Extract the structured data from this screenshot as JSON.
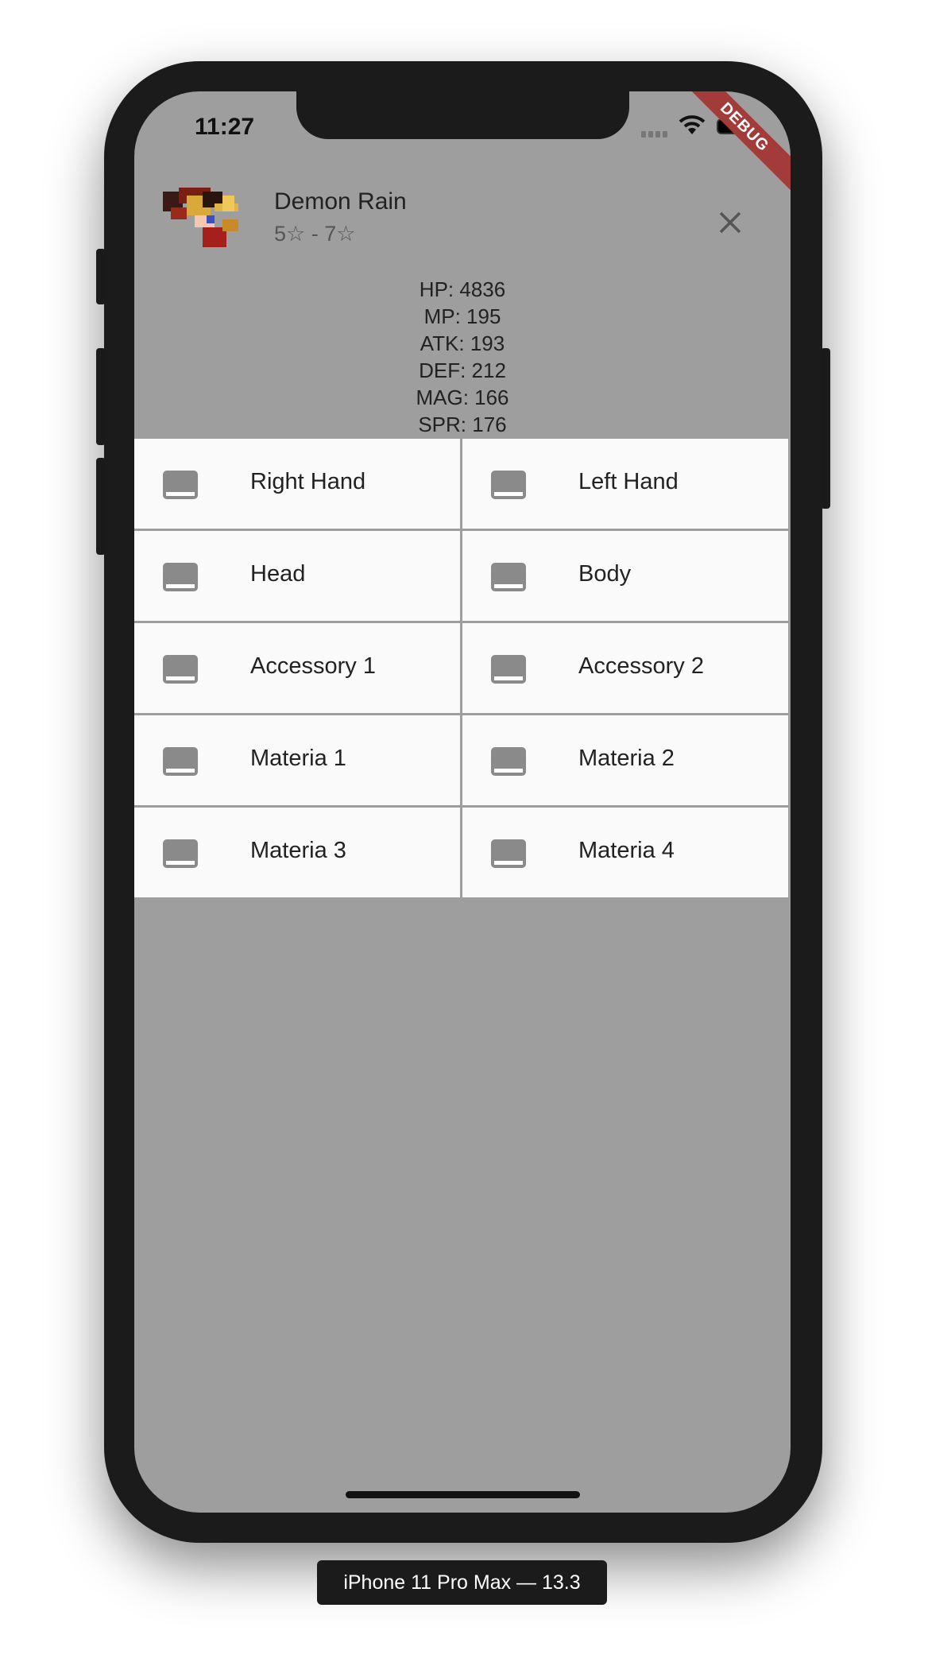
{
  "status_bar": {
    "time": "11:27",
    "debug_banner": "DEBUG"
  },
  "header": {
    "name": "Demon Rain",
    "rarity": "5☆ - 7☆",
    "close_icon": "close-icon"
  },
  "stats": [
    "HP: 4836",
    "MP: 195",
    "ATK: 193",
    "DEF: 212",
    "MAG: 166",
    "SPR: 176"
  ],
  "slots": [
    {
      "label": "Right Hand",
      "icon": "empty-slot-icon"
    },
    {
      "label": "Left Hand",
      "icon": "empty-slot-icon"
    },
    {
      "label": "Head",
      "icon": "empty-slot-icon"
    },
    {
      "label": "Body",
      "icon": "empty-slot-icon"
    },
    {
      "label": "Accessory 1",
      "icon": "empty-slot-icon"
    },
    {
      "label": "Accessory 2",
      "icon": "empty-slot-icon"
    },
    {
      "label": "Materia 1",
      "icon": "empty-slot-icon"
    },
    {
      "label": "Materia 2",
      "icon": "empty-slot-icon"
    },
    {
      "label": "Materia 3",
      "icon": "empty-slot-icon"
    },
    {
      "label": "Materia 4",
      "icon": "empty-slot-icon"
    }
  ],
  "device_label": "iPhone 11 Pro Max — 13.3",
  "colors": {
    "background": "#9e9e9e",
    "cell": "#fafafa",
    "debug": "#a33b3b"
  }
}
